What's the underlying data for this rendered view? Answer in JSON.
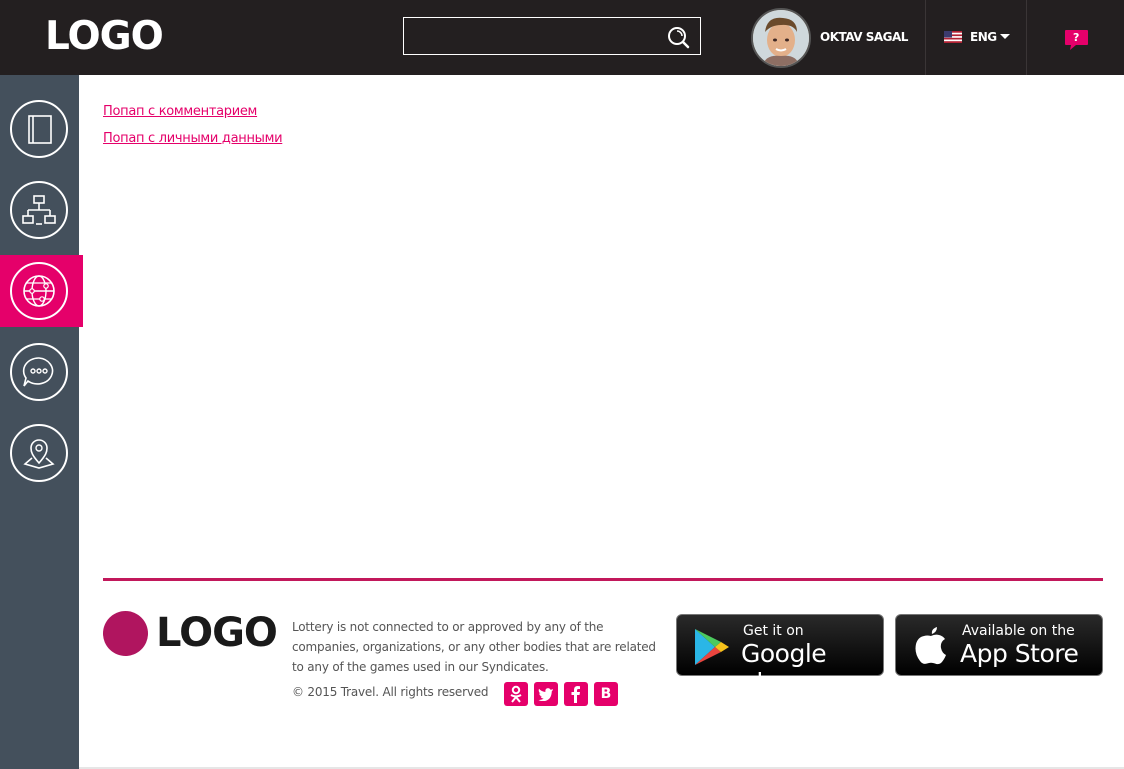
{
  "header": {
    "logo": "LOGO",
    "search": {
      "value": "",
      "placeholder": ""
    },
    "user": {
      "name": "OKTAV SAGAL"
    },
    "language": {
      "selected": "ENG"
    },
    "help_label": "?"
  },
  "sidebar": {
    "items": [
      {
        "name": "book",
        "icon": "book-icon",
        "active": false
      },
      {
        "name": "network",
        "icon": "sitemap-icon",
        "active": false
      },
      {
        "name": "globe",
        "icon": "globe-icon",
        "active": true
      },
      {
        "name": "chat",
        "icon": "chat-icon",
        "active": false
      },
      {
        "name": "map",
        "icon": "map-pin-icon",
        "active": false
      }
    ]
  },
  "main": {
    "links": [
      {
        "label": "Попап с комментарием"
      },
      {
        "label": "Попап с личными данными"
      }
    ]
  },
  "footer": {
    "logo": "LOGO",
    "disclaimer": "Lottery is not connected to or approved by any of the companies, organizations, or any other bodies that are related to any of the games used in our Syndicates.",
    "copyright": "© 2015 Travel. All rights reserved",
    "social": [
      {
        "icon": "odnoklassniki-icon"
      },
      {
        "icon": "twitter-icon"
      },
      {
        "icon": "facebook-icon"
      },
      {
        "icon": "vk-icon",
        "label": "B"
      }
    ],
    "stores": {
      "google": {
        "small": "Get it on",
        "big": "Google play"
      },
      "apple": {
        "small": "Available on the",
        "big": "App Store"
      }
    }
  },
  "colors": {
    "accent": "#e5006a",
    "header_bg": "#231f20",
    "sidebar_bg": "#44505c",
    "footer_line": "#c2185b"
  }
}
